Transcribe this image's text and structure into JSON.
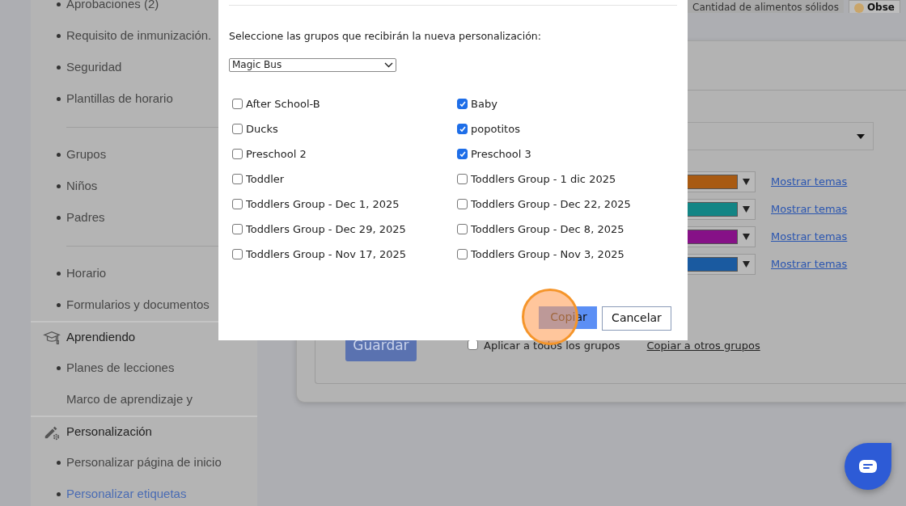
{
  "sidebar": {
    "groups": [
      {
        "items": [
          {
            "label": "Aprobaciones (2)",
            "bullet": true,
            "selected": false
          },
          {
            "label": "Requisito de inmunización.",
            "bullet": true,
            "selected": false
          },
          {
            "label": "Seguridad",
            "bullet": true,
            "selected": false
          },
          {
            "label": "Plantillas de horario",
            "bullet": true,
            "selected": false
          }
        ]
      },
      {
        "items": [
          {
            "label": "Grupos",
            "bullet": true,
            "selected": false
          },
          {
            "label": "Niños",
            "bullet": true,
            "selected": false
          },
          {
            "label": "Padres",
            "bullet": true,
            "selected": false
          }
        ]
      },
      {
        "items": [
          {
            "label": "Horario",
            "bullet": true,
            "selected": false
          },
          {
            "label": "Formularios y documentos",
            "bullet": true,
            "selected": false
          }
        ]
      },
      {
        "header": "Aprendiendo",
        "items": [
          {
            "label": "Planes de lecciones",
            "bullet": true,
            "selected": false
          },
          {
            "label": "Marco de aprendizaje y",
            "bullet": false,
            "selected": false
          }
        ]
      },
      {
        "header": "Personalización",
        "items": [
          {
            "label": "Personalizar página de inicio",
            "bullet": true,
            "selected": false
          },
          {
            "label": "Personalizar etiquetas",
            "bullet": true,
            "selected": true
          }
        ]
      }
    ]
  },
  "tabs": [
    {
      "label": "Cantidad de alimentos sólidos",
      "selected": false
    },
    {
      "label": "Obse",
      "selected": true
    }
  ],
  "color_rows": [
    {
      "color": "#a85a12",
      "link": "Mostrar temas"
    },
    {
      "color": "#138585",
      "link": "Mostrar temas"
    },
    {
      "color": "#861187",
      "link": "Mostrar temas"
    },
    {
      "color": "#1a5aa0",
      "link": "Mostrar temas"
    }
  ],
  "save_button": "Guardar",
  "apply_all": {
    "label": "Aplicar a todos los grupos",
    "checked": false
  },
  "copy_link": "Copiar a otros grupos",
  "dialog": {
    "prompt": "Seleccione las grupos que recibirán la nueva personalización:",
    "select": {
      "value": "Magic Bus"
    },
    "groups": [
      {
        "label": "After School-B",
        "checked": false
      },
      {
        "label": "Baby",
        "checked": true
      },
      {
        "label": "Ducks",
        "checked": false
      },
      {
        "label": "popotitos",
        "checked": true
      },
      {
        "label": "Preschool 2",
        "checked": false
      },
      {
        "label": "Preschool 3",
        "checked": true
      },
      {
        "label": "Toddler",
        "checked": false
      },
      {
        "label": "Toddlers Group - 1 dic 2025",
        "checked": false
      },
      {
        "label": "Toddlers Group - Dec 1, 2025",
        "checked": false
      },
      {
        "label": "Toddlers Group - Dec 22, 2025",
        "checked": false
      },
      {
        "label": "Toddlers Group - Dec 29, 2025",
        "checked": false
      },
      {
        "label": "Toddlers Group - Dec 8, 2025",
        "checked": false
      },
      {
        "label": "Toddlers Group - Nov 17, 2025",
        "checked": false
      },
      {
        "label": "Toddlers Group - Nov 3, 2025",
        "checked": false
      }
    ],
    "buttons": [
      "Copiar",
      "Cancelar"
    ]
  }
}
